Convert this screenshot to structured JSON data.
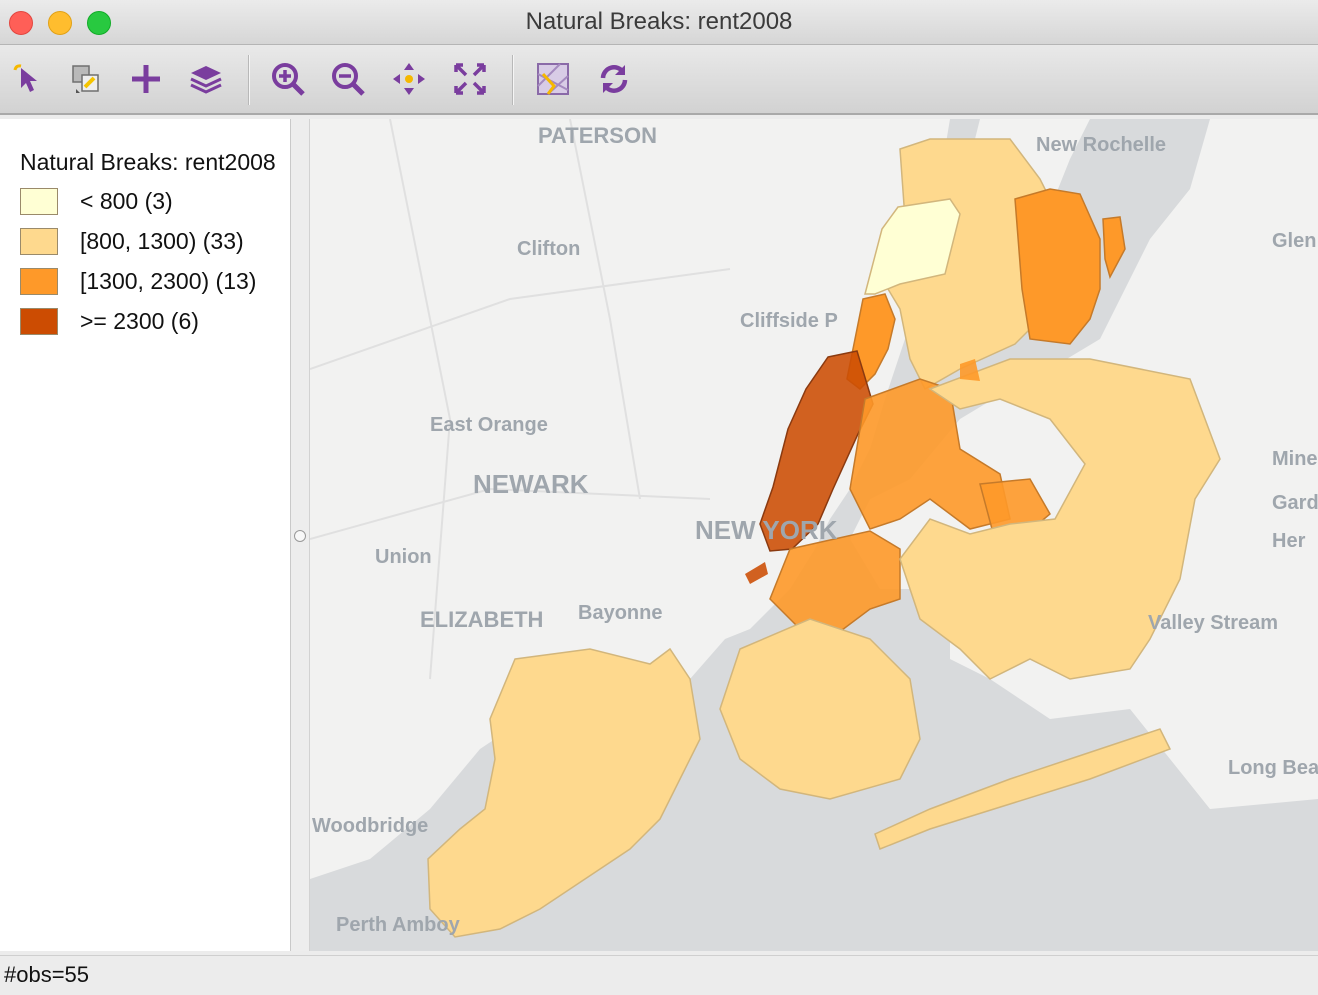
{
  "window": {
    "title": "Natural Breaks: rent2008"
  },
  "toolbar": {
    "tools": [
      {
        "icon": "select-pointer-icon"
      },
      {
        "icon": "selection-shape-icon"
      },
      {
        "icon": "add-layer-icon"
      },
      {
        "icon": "layers-icon"
      },
      {
        "icon": "zoom-in-icon"
      },
      {
        "icon": "zoom-out-icon"
      },
      {
        "icon": "pan-icon"
      },
      {
        "icon": "full-extent-icon"
      },
      {
        "icon": "basemap-icon"
      },
      {
        "icon": "refresh-icon"
      }
    ]
  },
  "legend": {
    "title": "Natural Breaks: rent2008",
    "items": [
      {
        "label": "< 800 (3)",
        "color": "#ffffd4"
      },
      {
        "label": "[800, 1300) (33)",
        "color": "#fed98e"
      },
      {
        "label": "[1300, 2300) (13)",
        "color": "#fe9929"
      },
      {
        "label": ">= 2300 (6)",
        "color": "#cc4c02"
      }
    ]
  },
  "map": {
    "places": {
      "paterson": "PATERSON",
      "new_rochelle": "New Rochelle",
      "clifton": "Clifton",
      "glen": "Glen",
      "cliffside": "Cliffside P",
      "east_orange": "East Orange",
      "newark": "NEWARK",
      "mine": "Mine",
      "garde": "Garde",
      "her": "Her",
      "new_york": "NEW YORK",
      "union": "Union",
      "elizabeth": "ELIZABETH",
      "bayonne": "Bayonne",
      "valley_stream": "Valley Stream",
      "long_beach": "Long Bea",
      "woodbridge": "Woodbridge",
      "perth_amboy": "Perth Amboy"
    }
  },
  "status": {
    "obs": "#obs=55"
  }
}
